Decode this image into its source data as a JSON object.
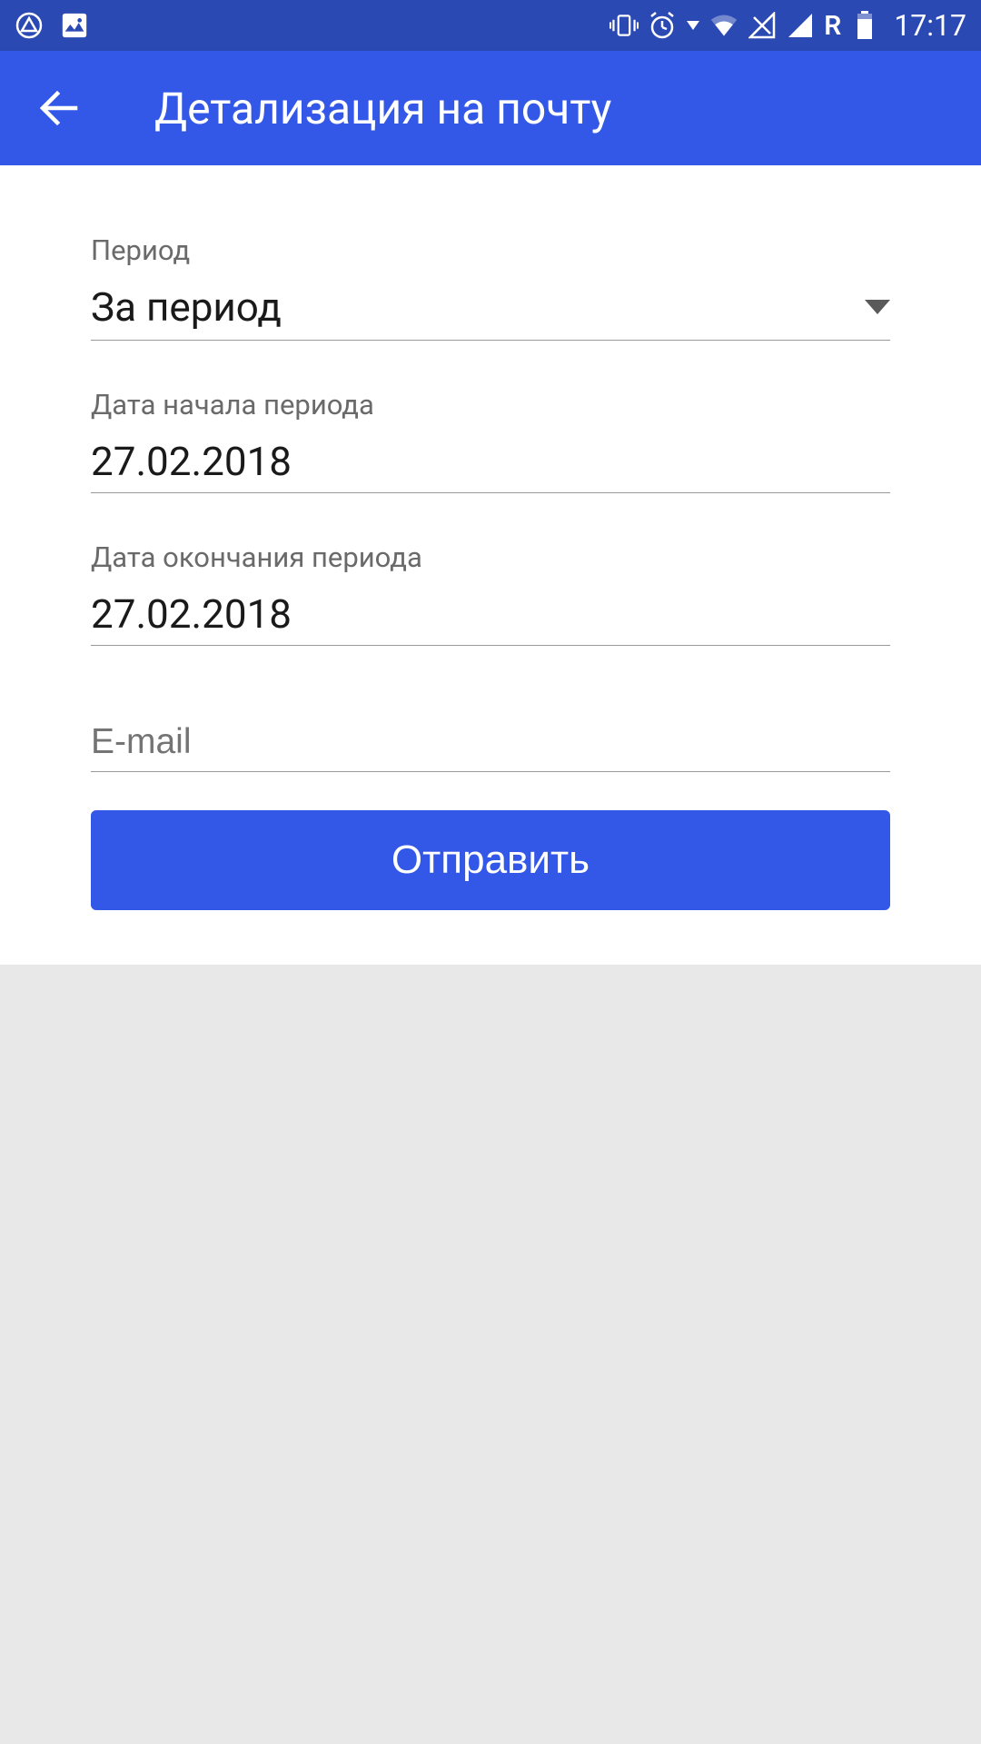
{
  "status": {
    "time": "17:17",
    "roaming": "R"
  },
  "header": {
    "title": "Детализация на почту"
  },
  "form": {
    "period_label": "Период",
    "period_value": "За период",
    "start_date_label": "Дата начала периода",
    "start_date_value": "27.02.2018",
    "end_date_label": "Дата окончания периода",
    "end_date_value": "27.02.2018",
    "email_placeholder": "E-mail",
    "email_value": "",
    "submit_label": "Отправить"
  }
}
